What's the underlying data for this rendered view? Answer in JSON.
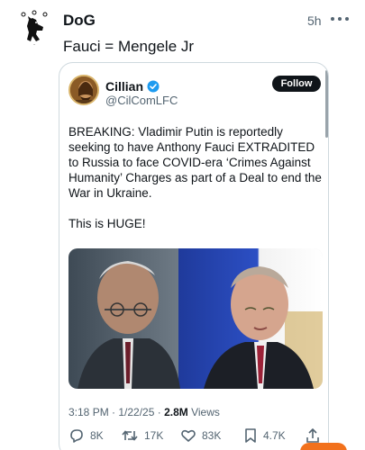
{
  "post": {
    "author": "DoG",
    "time": "5h",
    "text": "Fauci = Mengele Jr"
  },
  "quoted": {
    "name": "Cillian",
    "handle": "@CilComLFC",
    "follow_label": "Follow",
    "body": [
      "BREAKING: Vladimir Putin is reportedly seeking to have Anthony Fauci EXTRADITED to Russia to face COVID-era ‘Crimes Against Humanity’ Charges as part of a Deal to end the War in Ukraine.",
      "This is HUGE!"
    ],
    "timestamp": "3:18 PM · 1/22/25 · ",
    "views_count": "2.8M",
    "views_label": " Views",
    "stats": {
      "replies": "8K",
      "reposts": "17K",
      "likes": "83K",
      "bookmarks": "4.7K"
    }
  },
  "colors": {
    "text": "#0f1419",
    "secondary": "#536471",
    "verified": "#1d9bf0",
    "follow_bg": "#0f1419",
    "accent_orange": "#f2711c"
  },
  "icons": [
    "logo-dog-icon",
    "more-icon",
    "verified-icon",
    "reply-icon",
    "repost-icon",
    "like-icon",
    "bookmark-icon",
    "share-icon"
  ]
}
